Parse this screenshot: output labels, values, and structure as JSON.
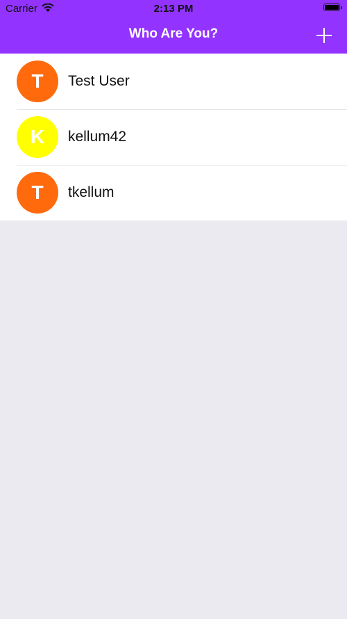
{
  "status_bar": {
    "carrier": "Carrier",
    "time": "2:13 PM",
    "wifi_icon": "wifi-icon",
    "battery_icon": "battery-full-icon"
  },
  "nav": {
    "title": "Who Are You?",
    "add_icon": "plus-icon",
    "color": "#9233ff"
  },
  "users": [
    {
      "initial": "T",
      "name": "Test User",
      "color": "#ff6a0d"
    },
    {
      "initial": "K",
      "name": "kellum42",
      "color": "#ffff00"
    },
    {
      "initial": "T",
      "name": "tkellum",
      "color": "#ff6a0d"
    }
  ]
}
